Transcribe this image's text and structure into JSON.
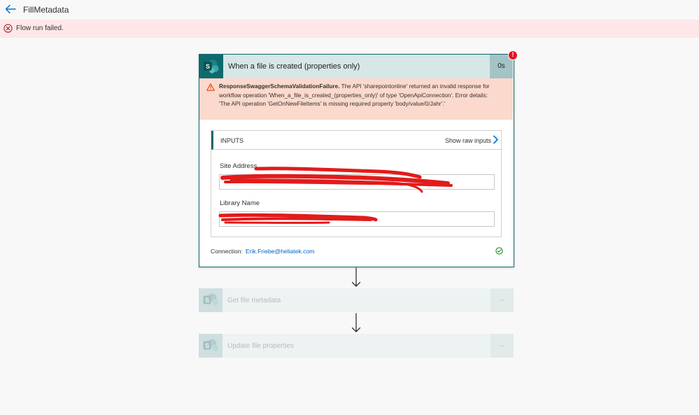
{
  "header": {
    "title": "FillMetadata"
  },
  "banner": {
    "message": "Flow run failed."
  },
  "trigger": {
    "title": "When a file is created (properties only)",
    "duration": "0s",
    "badge": "!",
    "error": {
      "code": "ResponseSwaggerSchemaValidationFailure.",
      "message": "The API 'sharepointonline' returned an invalid response for workflow operation 'When_a_file_is_created_(properties_only)' of type 'OpenApiConnection'. Error details: 'The API operation 'GetOnNewFileItems' is missing required property 'body/value/0/Jahr'.'"
    },
    "inputs": {
      "header": "INPUTS",
      "raw_link": "Show raw inputs",
      "fields": [
        {
          "label": "Site Address",
          "value": ""
        },
        {
          "label": "Library Name",
          "value": ""
        }
      ]
    },
    "connection": {
      "label": "Connection:",
      "account": "Erik.Friebe@heliatek.com"
    }
  },
  "steps": [
    {
      "title": "Get file metadata",
      "duration": "--"
    },
    {
      "title": "Update file properties",
      "duration": "--"
    }
  ],
  "colors": {
    "accent": "#0f6a6d",
    "error_banner": "#fde7e9",
    "error_box": "#fbd9cc",
    "error_red": "#e81123",
    "link_blue": "#0064bf",
    "success_green": "#107c10",
    "redaction_red": "#e21b1b"
  },
  "icons": {
    "back": "back-arrow-icon",
    "banner": "error-circle-icon",
    "service": "sharepoint-icon",
    "warning": "warning-triangle-icon",
    "chevron": "chevron-right-icon",
    "connection_status": "check-circle-icon",
    "flow": "down-arrow-icon"
  }
}
